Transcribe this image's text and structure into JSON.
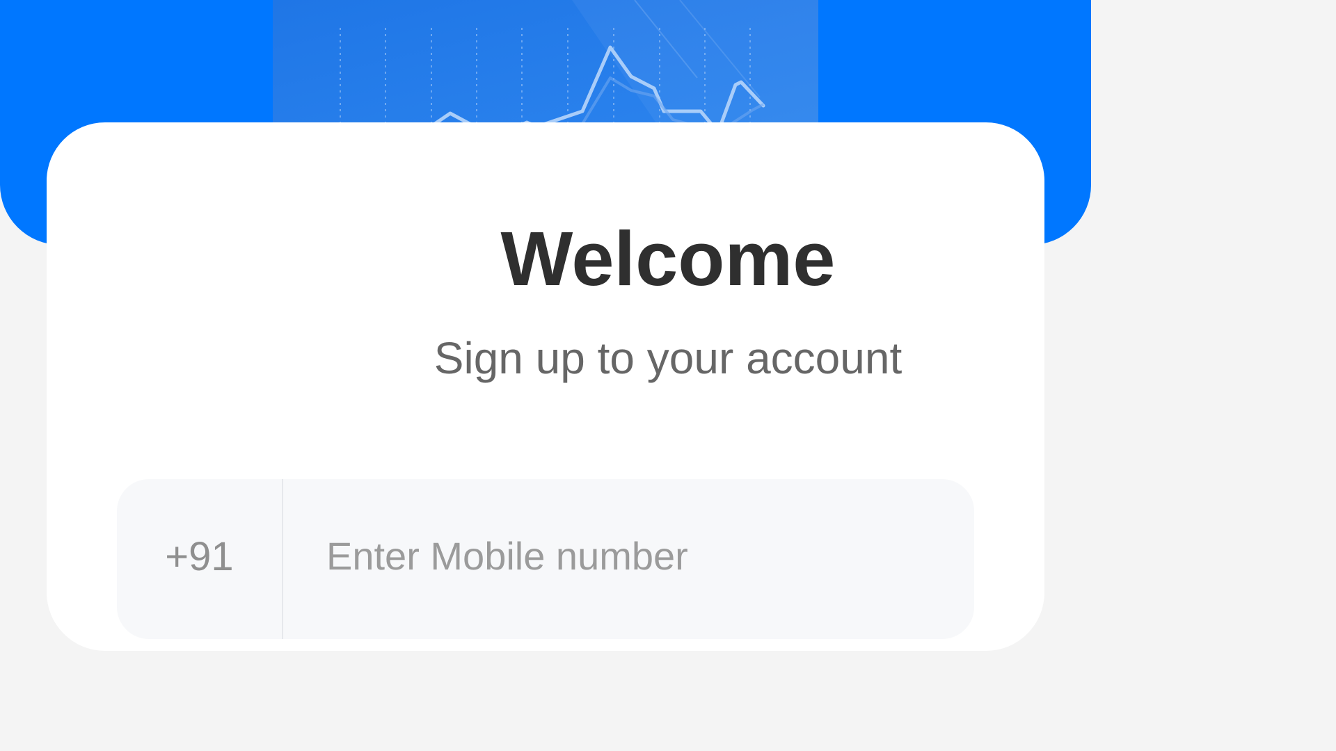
{
  "colors": {
    "brand": "#0077ff",
    "background": "#f4f4f4",
    "card": "#ffffff",
    "title": "#2f2f2f",
    "subtitle": "#666666",
    "input_bg": "#f7f8fa"
  },
  "header": {
    "illustration": "stock-chart-graphic"
  },
  "signup": {
    "title": "Welcome",
    "subtitle": "Sign up to your account",
    "country_code": "+91",
    "mobile_placeholder": "Enter Mobile number",
    "mobile_value": ""
  }
}
